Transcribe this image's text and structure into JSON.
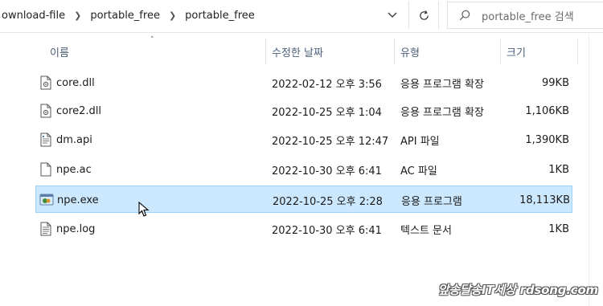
{
  "address": {
    "crumbs": [
      "ownload-file",
      "portable_free",
      "portable_free"
    ]
  },
  "search": {
    "placeholder": "portable_free 검색"
  },
  "columns": {
    "name": "이름",
    "date": "수정한 날짜",
    "type": "유형",
    "size": "크기"
  },
  "files": [
    {
      "name": "core.dll",
      "date": "2022-02-12 오후 3:56",
      "type": "응용 프로그램 확장",
      "size": "99KB",
      "icon": "dll-file-icon"
    },
    {
      "name": "core2.dll",
      "date": "2022-10-25 오후 1:04",
      "type": "응용 프로그램 확장",
      "size": "1,106KB",
      "icon": "dll-file-icon"
    },
    {
      "name": "dm.api",
      "date": "2022-10-25 오후 12:47",
      "type": "API 파일",
      "size": "1,390KB",
      "icon": "api-file-icon"
    },
    {
      "name": "npe.ac",
      "date": "2022-10-30 오후 6:41",
      "type": "AC 파일",
      "size": "1KB",
      "icon": "blank-file-icon"
    },
    {
      "name": "npe.exe",
      "date": "2022-10-25 오후 2:28",
      "type": "응용 프로그램",
      "size": "18,113KB",
      "icon": "exe-file-icon",
      "selected": true
    },
    {
      "name": "npe.log",
      "date": "2022-10-30 오후 6:41",
      "type": "텍스트 문서",
      "size": "1KB",
      "icon": "text-file-icon"
    }
  ],
  "watermark": "앞송달송IT세상 rdsong.com",
  "colors": {
    "selection_bg": "#cce8ff",
    "selection_border": "#99d1ff",
    "header_text": "#4c607a"
  }
}
